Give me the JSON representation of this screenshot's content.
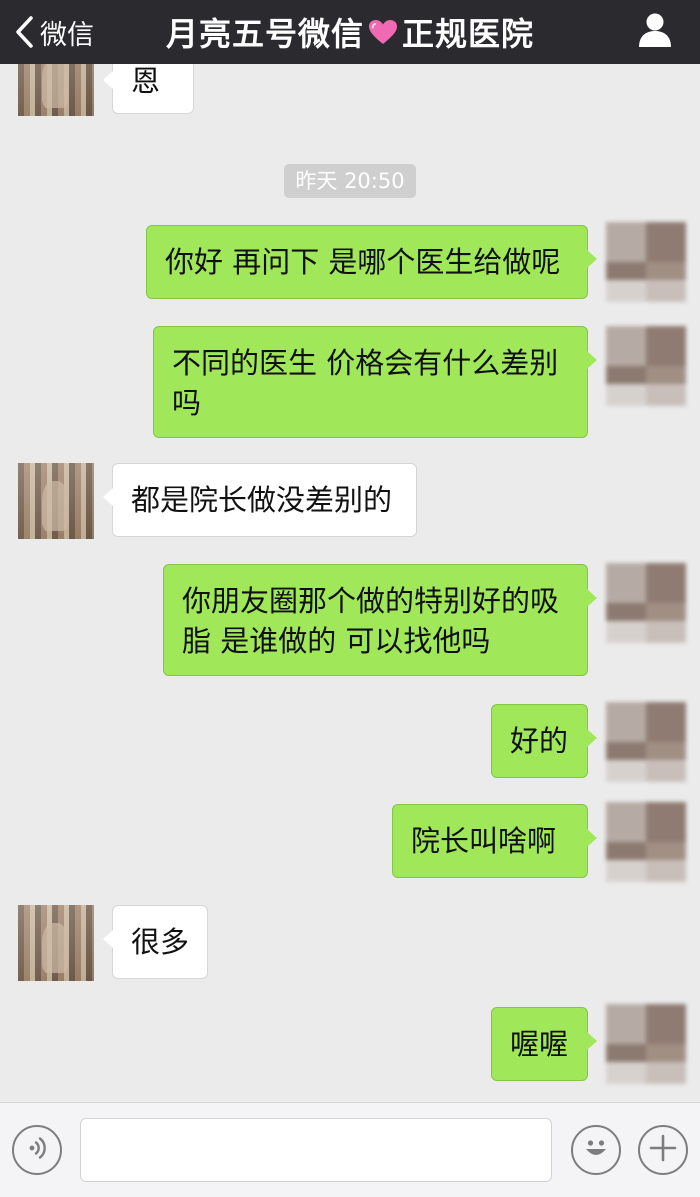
{
  "header": {
    "back_label": "微信",
    "title_prefix": "月亮五号微信",
    "title_suffix": "正规医院"
  },
  "chat": {
    "timestamp": "昨天 20:50",
    "messages": [
      {
        "side": "in",
        "text": "恩"
      },
      {
        "side": "out",
        "text": "你好 再问下 是哪个医生给做呢"
      },
      {
        "side": "out",
        "line1": "不同的医生 价格会有什么差别",
        "line2": "吗"
      },
      {
        "side": "in",
        "text": "都是院长做没差别的"
      },
      {
        "side": "out",
        "line1": "你朋友圈那个做的特别好的吸",
        "line2": "脂 是谁做的 可以找他吗"
      },
      {
        "side": "out",
        "text": "好的"
      },
      {
        "side": "out",
        "text": "院长叫啥啊"
      },
      {
        "side": "in",
        "text": "很多"
      },
      {
        "side": "out",
        "text": "喔喔"
      }
    ]
  },
  "input": {
    "value": ""
  },
  "icons": {
    "back": "chevron-left-icon",
    "heart": "heart-icon",
    "profile": "person-icon",
    "voice": "voice-icon",
    "emoji": "emoji-icon",
    "plus": "plus-icon"
  },
  "colors": {
    "header_bg": "#2b2a2f",
    "chat_bg": "#ebebeb",
    "outgoing_bubble": "#a0e75a",
    "incoming_bubble": "#ffffff",
    "heart": "#f06ab3"
  }
}
